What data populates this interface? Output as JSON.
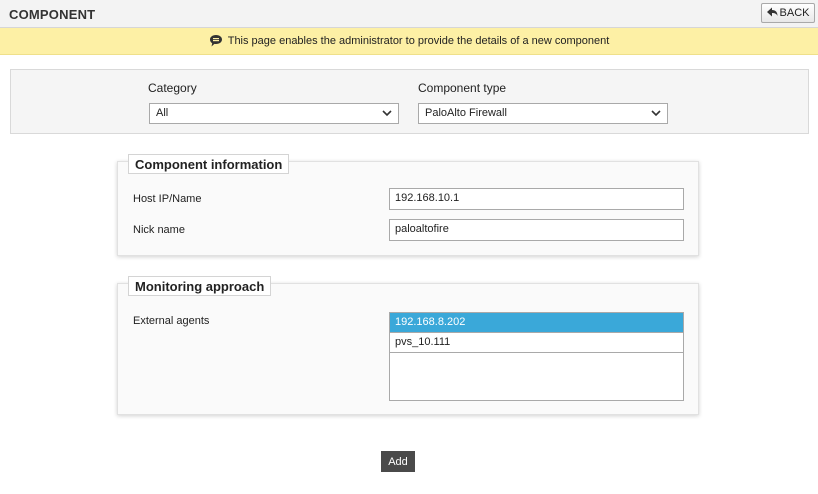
{
  "header": {
    "title": "COMPONENT",
    "back_label": "BACK"
  },
  "info": {
    "message": "This page enables the administrator to provide the details of a new component"
  },
  "filters": {
    "category": {
      "label": "Category",
      "value": "All"
    },
    "component_type": {
      "label": "Component type",
      "value": "PaloAlto Firewall"
    }
  },
  "component_info": {
    "legend": "Component information",
    "host_label": "Host IP/Name",
    "host_value": "192.168.10.1",
    "nick_label": "Nick name",
    "nick_value": "paloaltofire"
  },
  "monitoring": {
    "legend": "Monitoring approach",
    "agents_label": "External agents",
    "agents": [
      "192.168.8.202",
      "pvs_10.111"
    ],
    "selected_index": 0
  },
  "actions": {
    "add_label": "Add"
  },
  "colors": {
    "info_bar": "#fdf0a5",
    "selected": "#3aa8d9",
    "add_button": "#4a4a4a"
  }
}
